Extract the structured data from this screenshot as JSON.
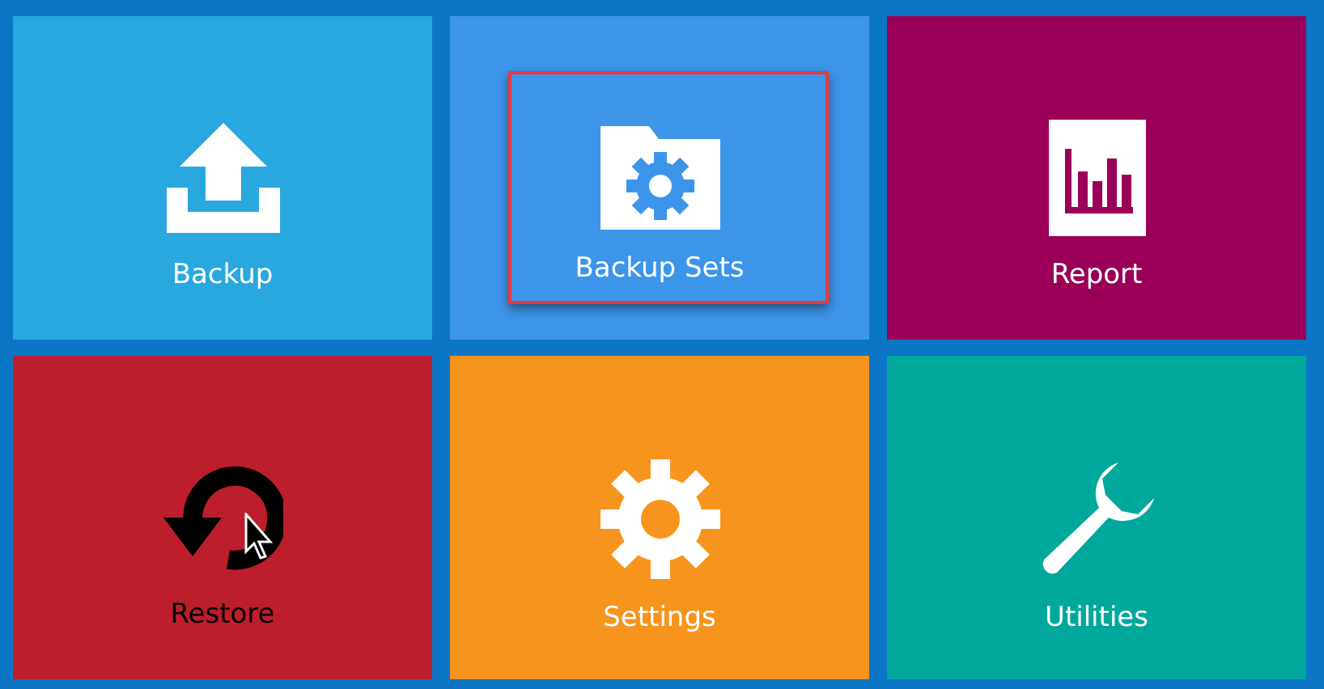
{
  "tiles": [
    {
      "kind": "backup",
      "label": "Backup",
      "color": "#29a8e0",
      "highlighted": false
    },
    {
      "kind": "backup_sets",
      "label": "Backup Sets",
      "color": "#3d95ea",
      "highlighted": true
    },
    {
      "kind": "report",
      "label": "Report",
      "color": "#9b0058",
      "highlighted": false
    },
    {
      "kind": "restore",
      "label": "Restore",
      "color": "#bd1e2c",
      "highlighted": false
    },
    {
      "kind": "settings",
      "label": "Settings",
      "color": "#f7941e",
      "highlighted": false
    },
    {
      "kind": "utilities",
      "label": "Utilities",
      "color": "#00a89c",
      "highlighted": false
    }
  ]
}
